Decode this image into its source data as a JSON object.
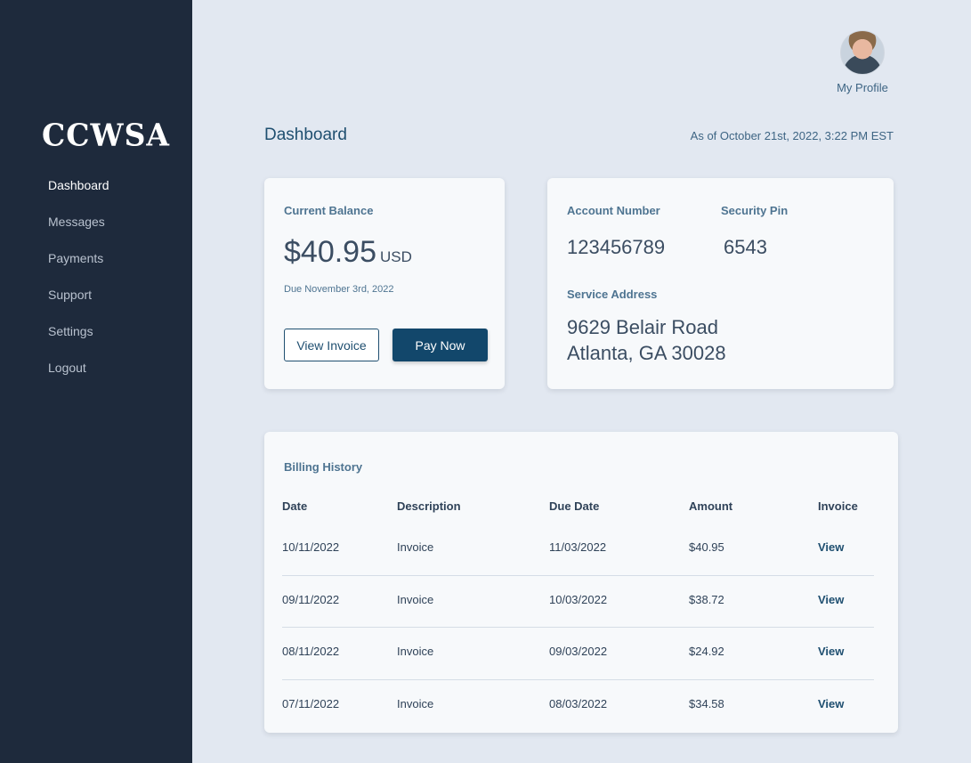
{
  "sidebar": {
    "logo": "CCWSA",
    "items": [
      {
        "label": "Dashboard",
        "active": true
      },
      {
        "label": "Messages",
        "active": false
      },
      {
        "label": "Payments",
        "active": false
      },
      {
        "label": "Support",
        "active": false
      },
      {
        "label": "Settings",
        "active": false
      },
      {
        "label": "Logout",
        "active": false
      }
    ]
  },
  "header": {
    "profile_label": "My Profile",
    "page_title": "Dashboard",
    "as_of": "As of October 21st, 2022, 3:22 PM EST"
  },
  "balance": {
    "label": "Current Balance",
    "amount": "$40.95",
    "currency": "USD",
    "due": "Due November 3rd, 2022",
    "view_invoice_label": "View Invoice",
    "pay_now_label": "Pay Now"
  },
  "account": {
    "number_label": "Account Number",
    "number": "123456789",
    "pin_label": "Security Pin",
    "pin": "6543",
    "address_label": "Service Address",
    "address_line1": "9629 Belair Road",
    "address_line2": "Atlanta, GA 30028"
  },
  "billing": {
    "title": "Billing History",
    "columns": [
      "Date",
      "Description",
      "Due Date",
      "Amount",
      "Invoice"
    ],
    "rows": [
      {
        "date": "10/11/2022",
        "description": "Invoice",
        "due_date": "11/03/2022",
        "amount": "$40.95",
        "invoice": "View"
      },
      {
        "date": "09/11/2022",
        "description": "Invoice",
        "due_date": "10/03/2022",
        "amount": "$38.72",
        "invoice": "View"
      },
      {
        "date": "08/11/2022",
        "description": "Invoice",
        "due_date": "09/03/2022",
        "amount": "$24.92",
        "invoice": "View"
      },
      {
        "date": "07/11/2022",
        "description": "Invoice",
        "due_date": "08/03/2022",
        "amount": "$34.58",
        "invoice": "View"
      }
    ]
  },
  "colors": {
    "sidebar_bg": "#1e2a3c",
    "page_bg": "#e2e8f1",
    "primary": "#12476b",
    "label": "#4e7491"
  }
}
